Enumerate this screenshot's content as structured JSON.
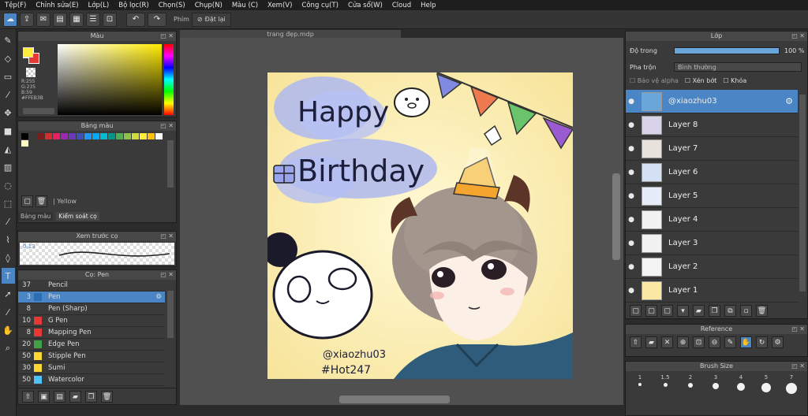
{
  "menu": [
    "Tệp(F)",
    "Chỉnh sửa(E)",
    "Lớp(L)",
    "Bộ lọc(R)",
    "Chọn(S)",
    "Chụp(N)",
    "Màu (C)",
    "Xem(V)",
    "Công cụ(T)",
    "Cửa sổ(W)",
    "Cloud",
    "Help"
  ],
  "toolbar": {
    "phim_label": "Phím",
    "reset_label": "Đặt lại"
  },
  "color_panel": {
    "title": "Màu",
    "r": "R:255",
    "g": "G:235",
    "b": "B:59",
    "hex": "#FFEB3B",
    "primary_color": "#ffeb3b"
  },
  "palette_panel": {
    "title": "Bảng màu",
    "swatch_name": "Yellow",
    "tabs": [
      "Bảng màu",
      "Kiểm soát cọ"
    ],
    "swatches": [
      "#000000",
      "#3a3a3a",
      "#7a1c1c",
      "#d32f2f",
      "#e91e63",
      "#9c27b0",
      "#673ab7",
      "#3f51b5",
      "#2196f3",
      "#03a9f4",
      "#00bcd4",
      "#009688",
      "#4caf50",
      "#8bc34a",
      "#cddc39",
      "#ffeb3b",
      "#ffc107",
      "#ffffff"
    ]
  },
  "brush_preview": {
    "title": "Xem trước cọ",
    "size": "0.13"
  },
  "brush_panel": {
    "title": "Cọ: Pen",
    "items": [
      {
        "num": "37",
        "name": "Pencil",
        "color": "#3a3a3a"
      },
      {
        "num": "3",
        "name": "Pen",
        "color": "#2b6db3"
      },
      {
        "num": "8",
        "name": "Pen (Sharp)",
        "color": "#3a3a3a"
      },
      {
        "num": "10",
        "name": "G Pen",
        "color": "#e53935"
      },
      {
        "num": "8",
        "name": "Mapping Pen",
        "color": "#e53935"
      },
      {
        "num": "20",
        "name": "Edge Pen",
        "color": "#43a047"
      },
      {
        "num": "50",
        "name": "Stipple Pen",
        "color": "#fdd835"
      },
      {
        "num": "30",
        "name": "Sumi",
        "color": "#fdd835"
      },
      {
        "num": "50",
        "name": "Watercolor",
        "color": "#4fc3f7"
      }
    ]
  },
  "document": {
    "tab_title": "trang đẹp.mdp"
  },
  "artwork": {
    "text_happy": "Happy",
    "text_birthday": "Birthday",
    "signature": "@xiaozhu03",
    "hashtag": "#Hot247"
  },
  "layer_panel": {
    "title": "Lớp",
    "opacity_label": "Độ trong",
    "opacity_value": "100 %",
    "blend_label": "Pha trộn",
    "blend_value": "Bình thường",
    "protect_alpha": "Bảo vệ alpha",
    "clipping": "Xén bớt",
    "lock": "Khóa",
    "layers": [
      {
        "name": "@xiaozhu03",
        "selected": true
      },
      {
        "name": "Layer 8",
        "selected": false
      },
      {
        "name": "Layer 7",
        "selected": false
      },
      {
        "name": "Layer 6",
        "selected": false
      },
      {
        "name": "Layer 5",
        "selected": false
      },
      {
        "name": "Layer 4",
        "selected": false
      },
      {
        "name": "Layer 3",
        "selected": false
      },
      {
        "name": "Layer 2",
        "selected": false
      },
      {
        "name": "Layer 1",
        "selected": false
      }
    ]
  },
  "reference_panel": {
    "title": "Reference"
  },
  "brush_size_panel": {
    "title": "Brush Size",
    "sizes": [
      "1",
      "1.5",
      "2",
      "3",
      "4",
      "5",
      "7"
    ]
  }
}
